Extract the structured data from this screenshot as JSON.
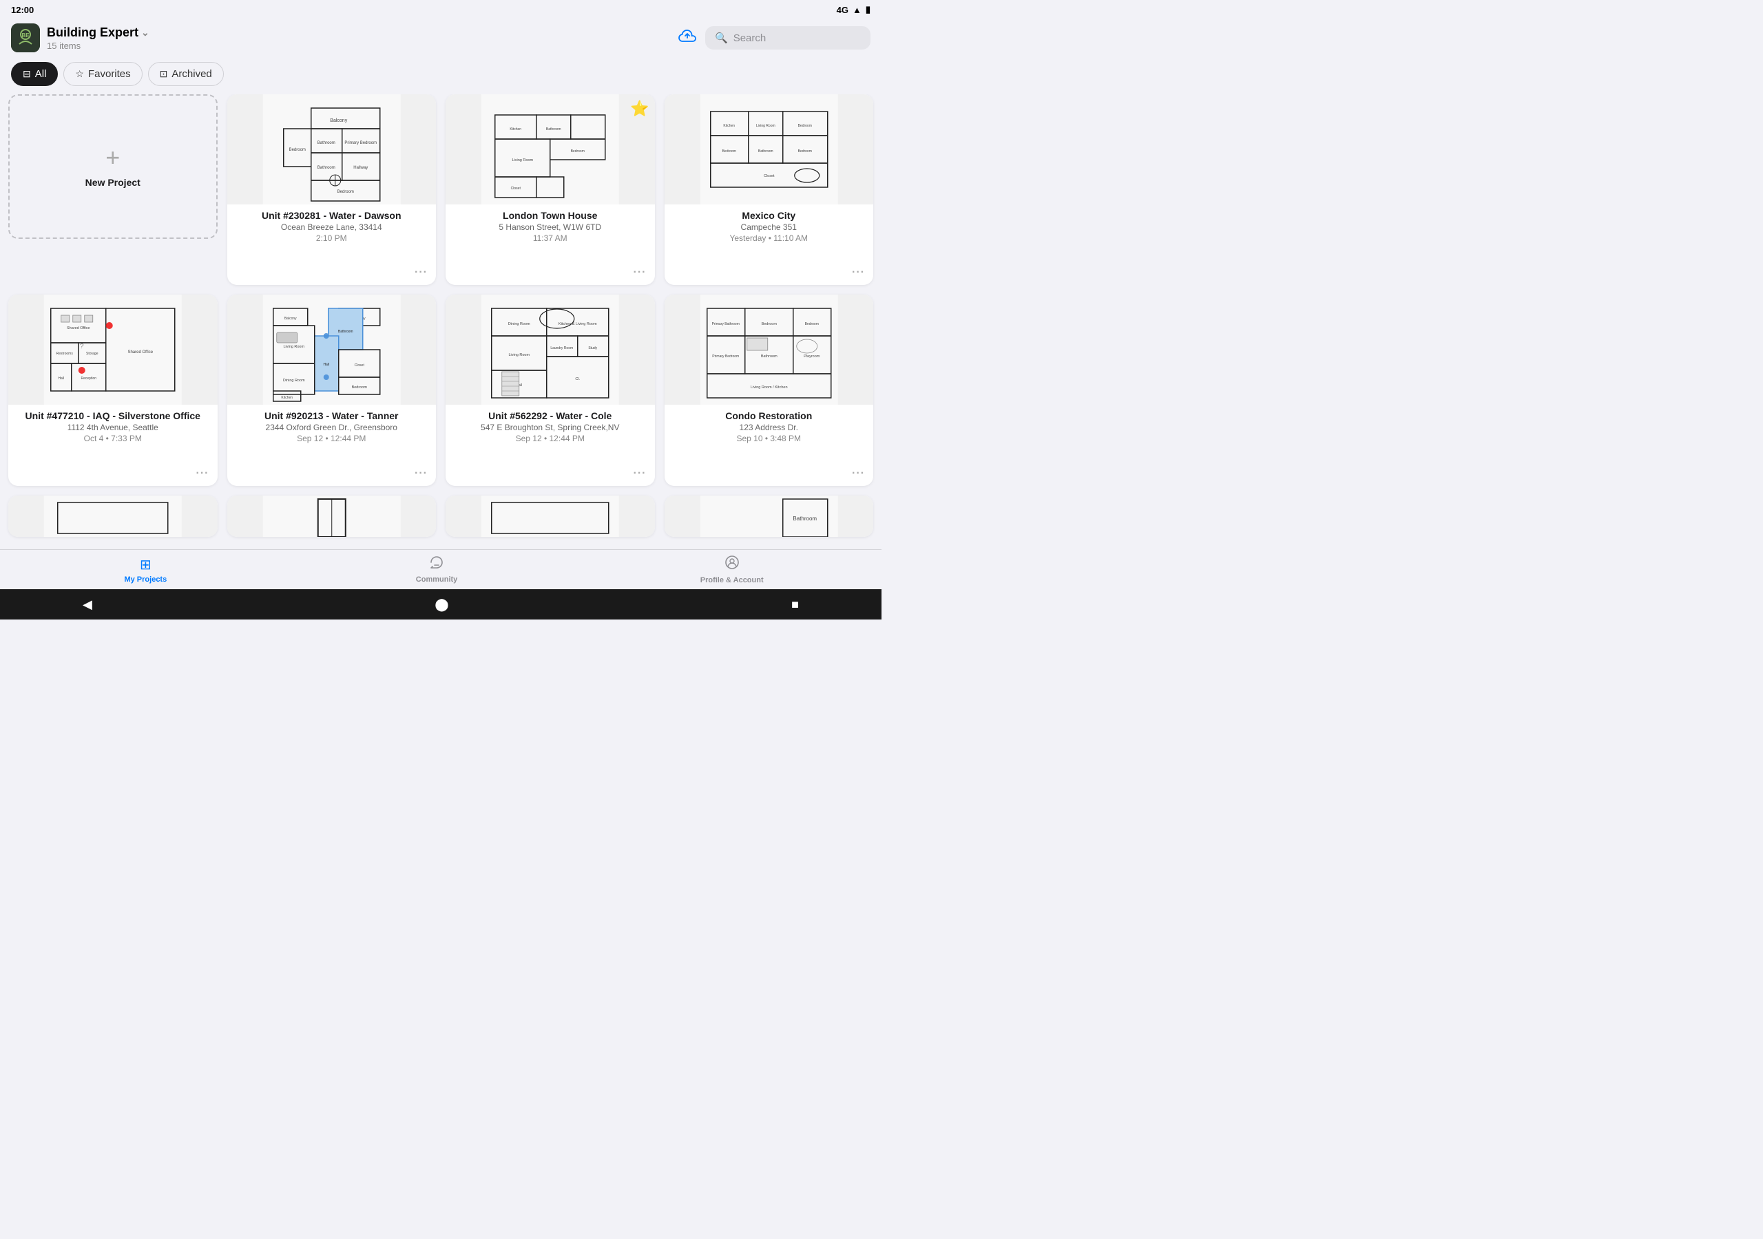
{
  "status": {
    "time": "12:00",
    "network": "4G",
    "signal": "▲",
    "battery": "🔋"
  },
  "header": {
    "logo_text": "BE",
    "title": "Building Expert",
    "chevron": "⌄",
    "subtitle": "15 items",
    "cloud_label": "cloud",
    "search_placeholder": "Search"
  },
  "tabs": [
    {
      "id": "all",
      "label": "All",
      "icon": "⊟",
      "active": true
    },
    {
      "id": "favorites",
      "label": "Favorites",
      "icon": "☆",
      "active": false
    },
    {
      "id": "archived",
      "label": "Archived",
      "icon": "⊡",
      "active": false
    }
  ],
  "projects": [
    {
      "id": "new",
      "type": "new",
      "label": "New Project"
    },
    {
      "id": "p1",
      "title": "Unit #230281 - Water - Dawson",
      "address": "Ocean Breeze Lane, 33414",
      "time": "2:10 PM",
      "favorite": false,
      "type": "project"
    },
    {
      "id": "p2",
      "title": "London Town House",
      "address": "5 Hanson Street, W1W 6TD",
      "time": "11:37 AM",
      "favorite": true,
      "type": "project"
    },
    {
      "id": "p3",
      "title": "Mexico City",
      "address": "Campeche 351",
      "time": "Yesterday • 11:10 AM",
      "favorite": false,
      "type": "project"
    },
    {
      "id": "p4",
      "title": "Unit #477210 - IAQ - Silverstone Office",
      "address": "1112 4th Avenue, Seattle",
      "time": "Oct 4 • 7:33 PM",
      "favorite": false,
      "type": "project"
    },
    {
      "id": "p5",
      "title": "Unit #920213 - Water - Tanner",
      "address": "2344 Oxford Green Dr., Greensboro",
      "time": "Sep 12 • 12:44 PM",
      "favorite": false,
      "type": "project"
    },
    {
      "id": "p6",
      "title": "Unit #562292 - Water - Cole",
      "address": "547 E Broughton St, Spring Creek,NV",
      "time": "Sep 12 • 12:44 PM",
      "favorite": false,
      "type": "project"
    },
    {
      "id": "p7",
      "title": "Condo Restoration",
      "address": "123 Address Dr.",
      "time": "Sep 10 • 3:48 PM",
      "favorite": false,
      "type": "project"
    }
  ],
  "nav": {
    "items": [
      {
        "id": "projects",
        "label": "My Projects",
        "icon": "⊞",
        "active": true
      },
      {
        "id": "community",
        "label": "Community",
        "icon": "💬",
        "active": false
      },
      {
        "id": "profile",
        "label": "Profile & Account",
        "icon": "👤",
        "active": false
      }
    ]
  },
  "android_nav": {
    "back": "◀",
    "home": "⬤",
    "recent": "■"
  }
}
